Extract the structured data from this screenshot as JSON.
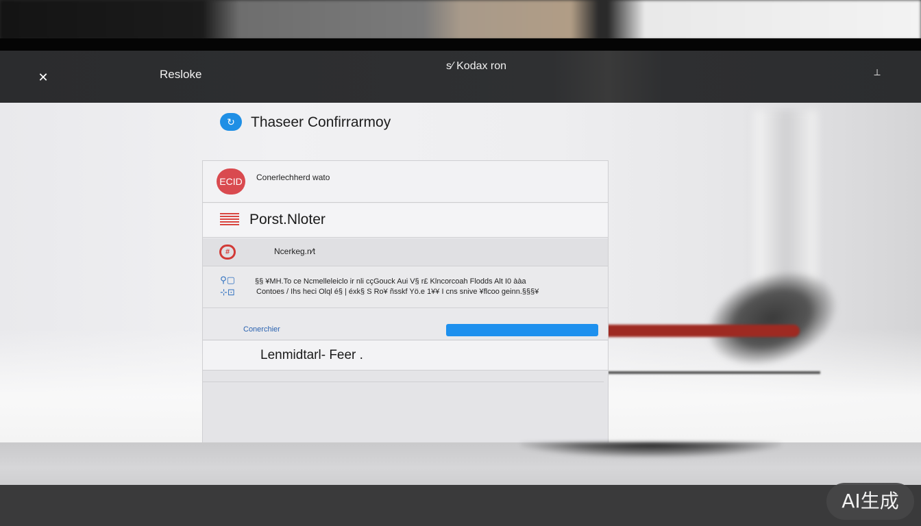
{
  "header": {
    "left_icon": "close-icon",
    "left_title": "Resloke",
    "center_title": "s⁄ Kodax ron",
    "right_icon": "pin-icon"
  },
  "page": {
    "heading_icon": "sync-icon",
    "heading": "Thaseer Confirrarmoy"
  },
  "card": {
    "row1": {
      "badge_text": "ECID",
      "label": "Conerlechherd wato"
    },
    "row2": {
      "icon": "flag-icon",
      "label": "Porst.Nloter"
    },
    "row3": {
      "icon": "network-grid-icon",
      "label": "Ncerkeg.n⁄t"
    },
    "row4": {
      "icon": "connection-icon",
      "line1": "§§ ¥MH.To ce  Ncmelleleiclo ir nli cçGouck  Aui  V§  r£ Klncorcoah Flodds Alt I0 ààa",
      "line2": "Contoes / Ihs heci  Olql é§ | éxk§ S  Ro¥ ñsskf Yö.e  1¥¥ I cns snive ¥flcoo geinn.§§§¥"
    },
    "row5": {
      "link": "Conerchier",
      "button_label": ""
    },
    "row6": {
      "label": "Lenmidtarl- Feer ."
    }
  },
  "watermark": {
    "text": "AI生成"
  },
  "colors": {
    "accent_blue": "#1e90ee",
    "alert_red": "#d94a4f",
    "header_bg": "#2e2f31"
  }
}
